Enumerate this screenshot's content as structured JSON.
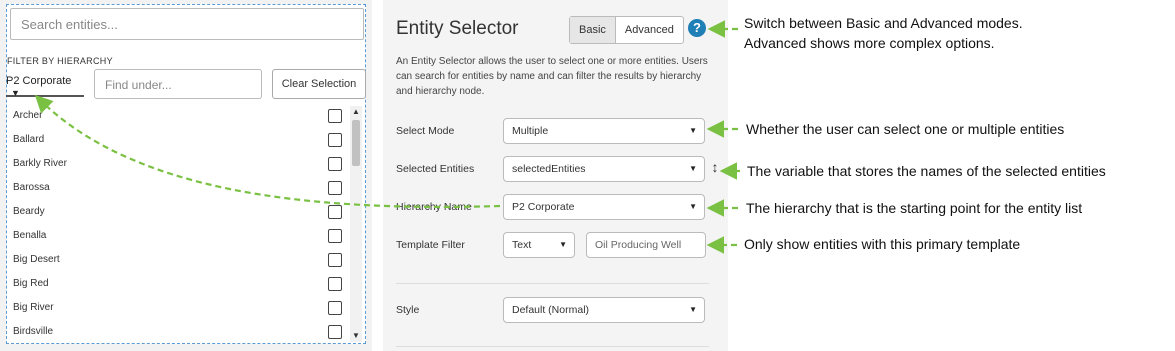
{
  "entity_widget": {
    "search_placeholder": "Search entities...",
    "filter_label": "FILTER BY HIERARCHY",
    "hierarchy_value": "P2 Corporate",
    "find_placeholder": "Find under...",
    "clear_button": "Clear Selection",
    "entities": [
      "Archer",
      "Ballard",
      "Barkly River",
      "Barossa",
      "Beardy",
      "Benalla",
      "Big Desert",
      "Big Red",
      "Big River",
      "Birdsville"
    ]
  },
  "panel": {
    "title": "Entity Selector",
    "modes": [
      "Basic",
      "Advanced"
    ],
    "active_mode": "Basic",
    "help_icon": "question-mark-icon",
    "description": "An Entity Selector allows the user to select one or more entities. Users can search for entities by name and can filter the results by hierarchy and hierarchy node.",
    "select_mode": {
      "label": "Select Mode",
      "value": "Multiple"
    },
    "selected_entities": {
      "label": "Selected Entities",
      "value": "selectedEntities"
    },
    "hierarchy_name": {
      "label": "Hierarchy Name",
      "value": "P2 Corporate"
    },
    "template_filter": {
      "label": "Template Filter",
      "type_value": "Text",
      "value": "Oil Producing Well"
    },
    "style": {
      "label": "Style",
      "value": "Default (Normal)"
    }
  },
  "annotations": {
    "modes_line1": "Switch between Basic and Advanced modes.",
    "modes_line2": "Advanced shows more complex options.",
    "select_mode": "Whether the user can select one or multiple entities",
    "selected_entities": "The variable that stores the names of the selected entities",
    "hierarchy": "The hierarchy that is the starting point for the entity list",
    "template": "Only show entities with this primary template"
  },
  "colors": {
    "arrow": "#7ac143",
    "accent": "#1f7fb7",
    "dashed_border": "#5b9bd5"
  }
}
